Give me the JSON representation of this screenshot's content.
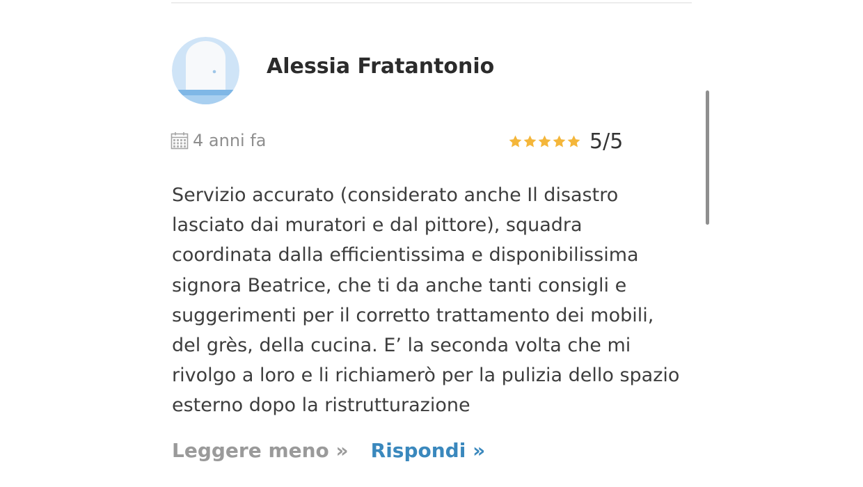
{
  "review": {
    "author": "Alessia Fratantonio",
    "date": "4 anni fa",
    "rating": 5,
    "rating_max": 5,
    "rating_text": "5/5",
    "text": "Servizio accurato (considerato anche Il disastro lasciato dai muratori e dal pittore), squadra coordinata dalla efficientissima e disponibilissima signora Beatrice, che ti da anche tanti consigli e suggerimenti per il corretto trattamento dei mobili, del grès, della cucina. E’ la seconda volta che mi rivolgo a loro e li richiamerò per la pulizia dello spazio esterno dopo la ristrutturazione",
    "read_less_label": "Leggere meno »",
    "reply_label": "Rispondi »"
  },
  "icons": {
    "avatar": "door-avatar-icon",
    "date": "calendar-icon",
    "star": "star-icon"
  },
  "colors": {
    "star": "#f4b63a",
    "reply_link": "#3a88bd",
    "read_less_link": "#9a9a9a",
    "avatar_background": "#cfe4f7"
  }
}
